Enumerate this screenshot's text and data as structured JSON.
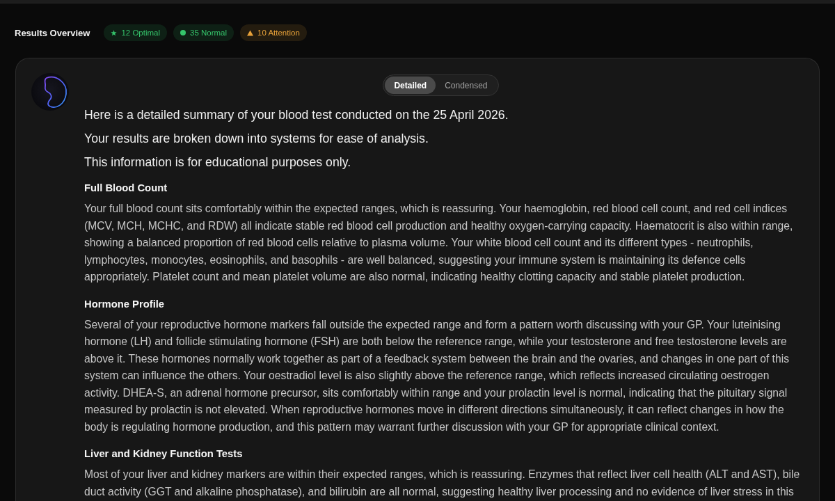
{
  "header": {
    "title": "Results Overview",
    "badges": [
      {
        "kind": "optimal",
        "label": "12 Optimal",
        "color": "#35c46b"
      },
      {
        "kind": "normal",
        "label": "35 Normal",
        "color": "#35c46b"
      },
      {
        "kind": "attention",
        "label": "10 Attention",
        "color": "#e8a23a"
      }
    ]
  },
  "summary": {
    "view_modes": [
      {
        "label": "Detailed",
        "selected": true
      },
      {
        "label": "Condensed",
        "selected": false
      }
    ],
    "intro": [
      "Here is a detailed summary of your blood test conducted on the 25 April 2026.",
      "Your results are broken down into systems for ease of analysis.",
      "This information is for educational purposes only."
    ],
    "sections": [
      {
        "heading": "Full Blood Count",
        "body": "Your full blood count sits comfortably within the expected ranges, which is reassuring. Your haemoglobin, red blood cell count, and red cell indices (MCV, MCH, MCHC, and RDW) all indicate stable red blood cell production and healthy oxygen-carrying capacity. Haematocrit is also within range, showing a balanced proportion of red blood cells relative to plasma volume. Your white blood cell count and its different types - neutrophils, lymphocytes, monocytes, eosinophils, and basophils - are well balanced, suggesting your immune system is maintaining its defence cells appropriately. Platelet count and mean platelet volume are also normal, indicating healthy clotting capacity and stable platelet production."
      },
      {
        "heading": "Hormone Profile",
        "body": "Several of your reproductive hormone markers fall outside the expected range and form a pattern worth discussing with your GP. Your luteinising hormone (LH) and follicle stimulating hormone (FSH) are both below the reference range, while your testosterone and free testosterone levels are above it. These hormones normally work together as part of a feedback system between the brain and the ovaries, and changes in one part of this system can influence the others. Your oestradiol level is also slightly above the reference range, which reflects increased circulating oestrogen activity. DHEA-S, an adrenal hormone precursor, sits comfortably within range and your prolactin level is normal, indicating that the pituitary signal measured by prolactin is not elevated. When reproductive hormones move in different directions simultaneously, it can reflect changes in how the body is regulating hormone production, and this pattern may warrant further discussion with your GP for appropriate clinical context."
      },
      {
        "heading": "Liver and Kidney Function Tests",
        "body": "Most of your liver and kidney markers are within their expected ranges, which is reassuring. Enzymes that reflect liver cell health (ALT and AST), bile duct activity (GGT and alkaline phosphatase), and bilirubin are all normal, suggesting healthy liver processing and no evidence of liver stress in this"
      }
    ]
  }
}
